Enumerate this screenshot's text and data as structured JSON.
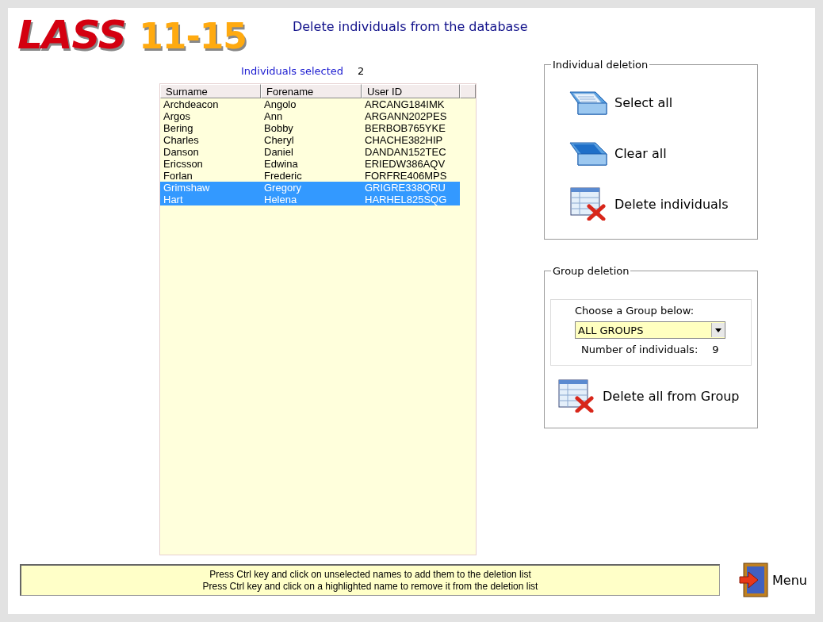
{
  "logo": {
    "word": "LASS",
    "number": "11-15"
  },
  "title": "Delete individuals from the database",
  "selection": {
    "label": "Individuals selected",
    "count": "2"
  },
  "table": {
    "columns": [
      "Surname",
      "Forename",
      "User ID"
    ],
    "rows": [
      {
        "cells": [
          "Archdeacon",
          "Angolo",
          "ARCANG184IMK"
        ],
        "selected": false
      },
      {
        "cells": [
          "Argos",
          "Ann",
          "ARGANN202PES"
        ],
        "selected": false
      },
      {
        "cells": [
          "Bering",
          "Bobby",
          "BERBOB765YKE"
        ],
        "selected": false
      },
      {
        "cells": [
          "Charles",
          "Cheryl",
          "CHACHE382HIP"
        ],
        "selected": false
      },
      {
        "cells": [
          "Danson",
          "Daniel",
          "DANDAN152TEC"
        ],
        "selected": false
      },
      {
        "cells": [
          "Ericsson",
          "Edwina",
          "ERIEDW386AQV"
        ],
        "selected": false
      },
      {
        "cells": [
          "Forlan",
          "Frederic",
          "FORFRE406MPS"
        ],
        "selected": false
      },
      {
        "cells": [
          "Grimshaw",
          "Gregory",
          "GRIGRE338QRU"
        ],
        "selected": true
      },
      {
        "cells": [
          "Hart",
          "Helena",
          "HARHEL825SQG"
        ],
        "selected": true
      }
    ]
  },
  "individual_deletion": {
    "title": "Individual deletion",
    "buttons": [
      {
        "label": "Select all",
        "kind": "full-tray"
      },
      {
        "label": "Clear all",
        "kind": "empty-tray"
      },
      {
        "label": "Delete individuals",
        "kind": "delete-table"
      }
    ]
  },
  "group_deletion": {
    "title": "Group deletion",
    "prompt": "Choose a Group below:",
    "group": "ALL GROUPS",
    "count_label": "Number of individuals:",
    "count": "9",
    "button": {
      "label": "Delete all from Group",
      "kind": "delete-table"
    }
  },
  "hint": [
    "Press Ctrl key and click on unselected names to add them to the deletion list",
    "Press Ctrl key and click on a highlighted name to remove it from the deletion list"
  ],
  "menu_button": "Menu"
}
